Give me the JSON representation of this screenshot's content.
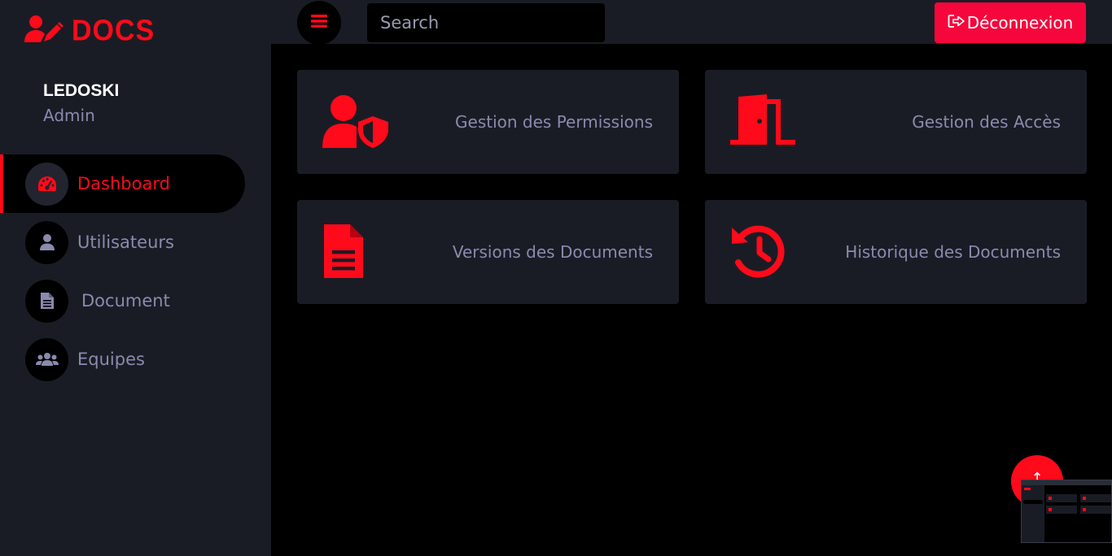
{
  "brand": {
    "name": "DOCS",
    "icon": "user-edit-icon"
  },
  "profile": {
    "name": "LEDOSKI",
    "role": "Admin"
  },
  "sidebar": {
    "items": [
      {
        "label": "Dashboard",
        "icon": "tachometer-icon",
        "active": true
      },
      {
        "label": "Utilisateurs",
        "icon": "user-icon",
        "active": false
      },
      {
        "label": "Document",
        "icon": "file-icon",
        "active": false
      },
      {
        "label": "Equipes",
        "icon": "users-icon",
        "active": false
      }
    ]
  },
  "topbar": {
    "menu_icon": "bars-icon",
    "search_placeholder": "Search",
    "logout_label": "Déconnexion",
    "logout_icon": "sign-out-icon"
  },
  "cards": [
    {
      "label": "Gestion des Permissions",
      "icon": "user-shield-icon"
    },
    {
      "label": "Gestion des Accès",
      "icon": "door-open-icon"
    },
    {
      "label": "Versions des Documents",
      "icon": "file-alt-icon"
    },
    {
      "label": "Historique des Documents",
      "icon": "history-icon"
    }
  ],
  "colors": {
    "accent": "#ff0a1a",
    "logout_bg": "#f5073c",
    "panel": "#1a1c25",
    "background": "#000000",
    "muted_text": "#8b8aae"
  }
}
